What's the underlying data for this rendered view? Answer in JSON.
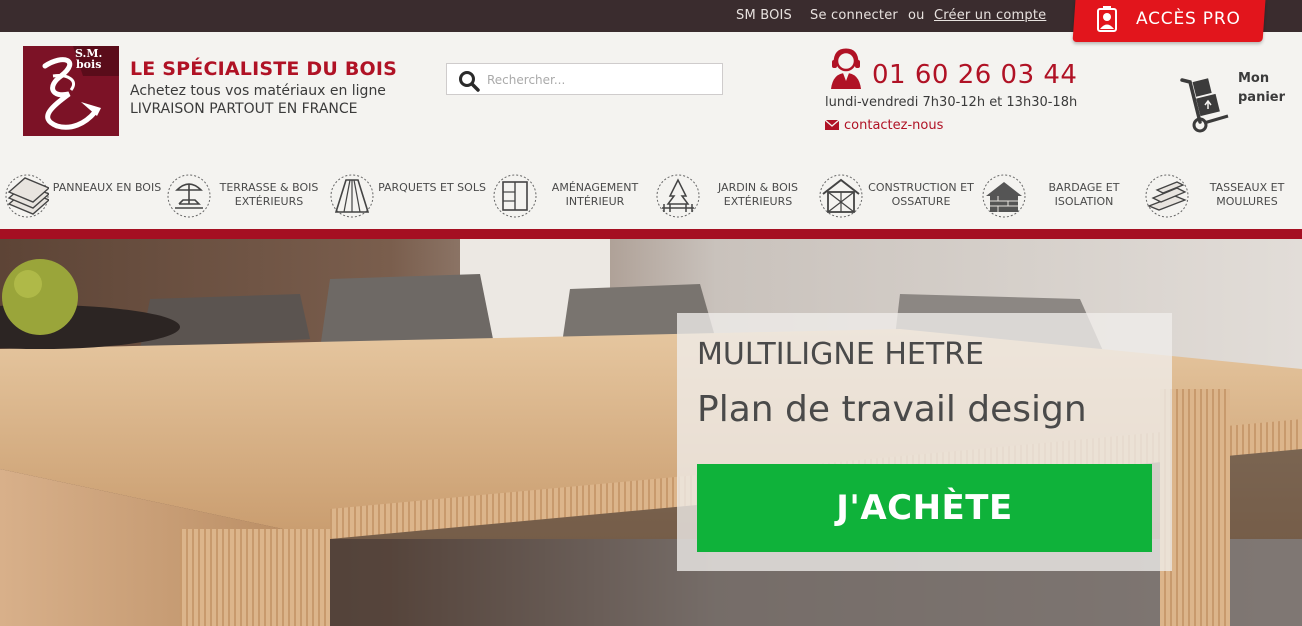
{
  "topbar": {
    "brand_link": "SM BOIS",
    "login": "Se connecter",
    "or": "ou",
    "register": "Créer un compte",
    "pro_button": "ACCÈS PRO",
    "pro_color": "#e2151c"
  },
  "logo": {
    "text_line1": "S.M.",
    "text_line2": "bois",
    "color": "#7c1226"
  },
  "brand": {
    "title": "LE SPÉCIALISTE DU BOIS",
    "subtitle": "Achetez tous vos matériaux en ligne",
    "tagline": "LIVRAISON PARTOUT EN FRANCE"
  },
  "search": {
    "placeholder": "Rechercher..."
  },
  "contact": {
    "phone": "01 60 26 03 44",
    "hours": "lundi-vendredi 7h30-12h et 13h30-18h",
    "contact_link": "contactez-nous"
  },
  "cart": {
    "label_line1": "Mon",
    "label_line2": "panier"
  },
  "categories": [
    {
      "label": "PANNEAUX EN BOIS",
      "icon": "panels-icon"
    },
    {
      "label": "TERRASSE & BOIS EXTÉRIEURS",
      "icon": "terrace-icon"
    },
    {
      "label": "PARQUETS ET SOLS",
      "icon": "parquet-icon"
    },
    {
      "label": "AMÉNAGEMENT INTÉRIEUR",
      "icon": "cabinet-icon"
    },
    {
      "label": "JARDIN & BOIS EXTÉRIEURS",
      "icon": "garden-icon"
    },
    {
      "label": "CONSTRUCTION ET OSSATURE",
      "icon": "house-frame-icon"
    },
    {
      "label": "BARDAGE ET ISOLATION",
      "icon": "cladding-icon"
    },
    {
      "label": "TASSEAUX ET MOULURES",
      "icon": "battens-icon"
    }
  ],
  "hero": {
    "line1": "MULTILIGNE HETRE",
    "line2": "Plan de travail design",
    "cta": "J'ACHÈTE",
    "cta_color": "#0fb23a"
  },
  "colors": {
    "accent": "#b01225",
    "topbar": "#3a2c2e",
    "divider": "#a50f22"
  }
}
